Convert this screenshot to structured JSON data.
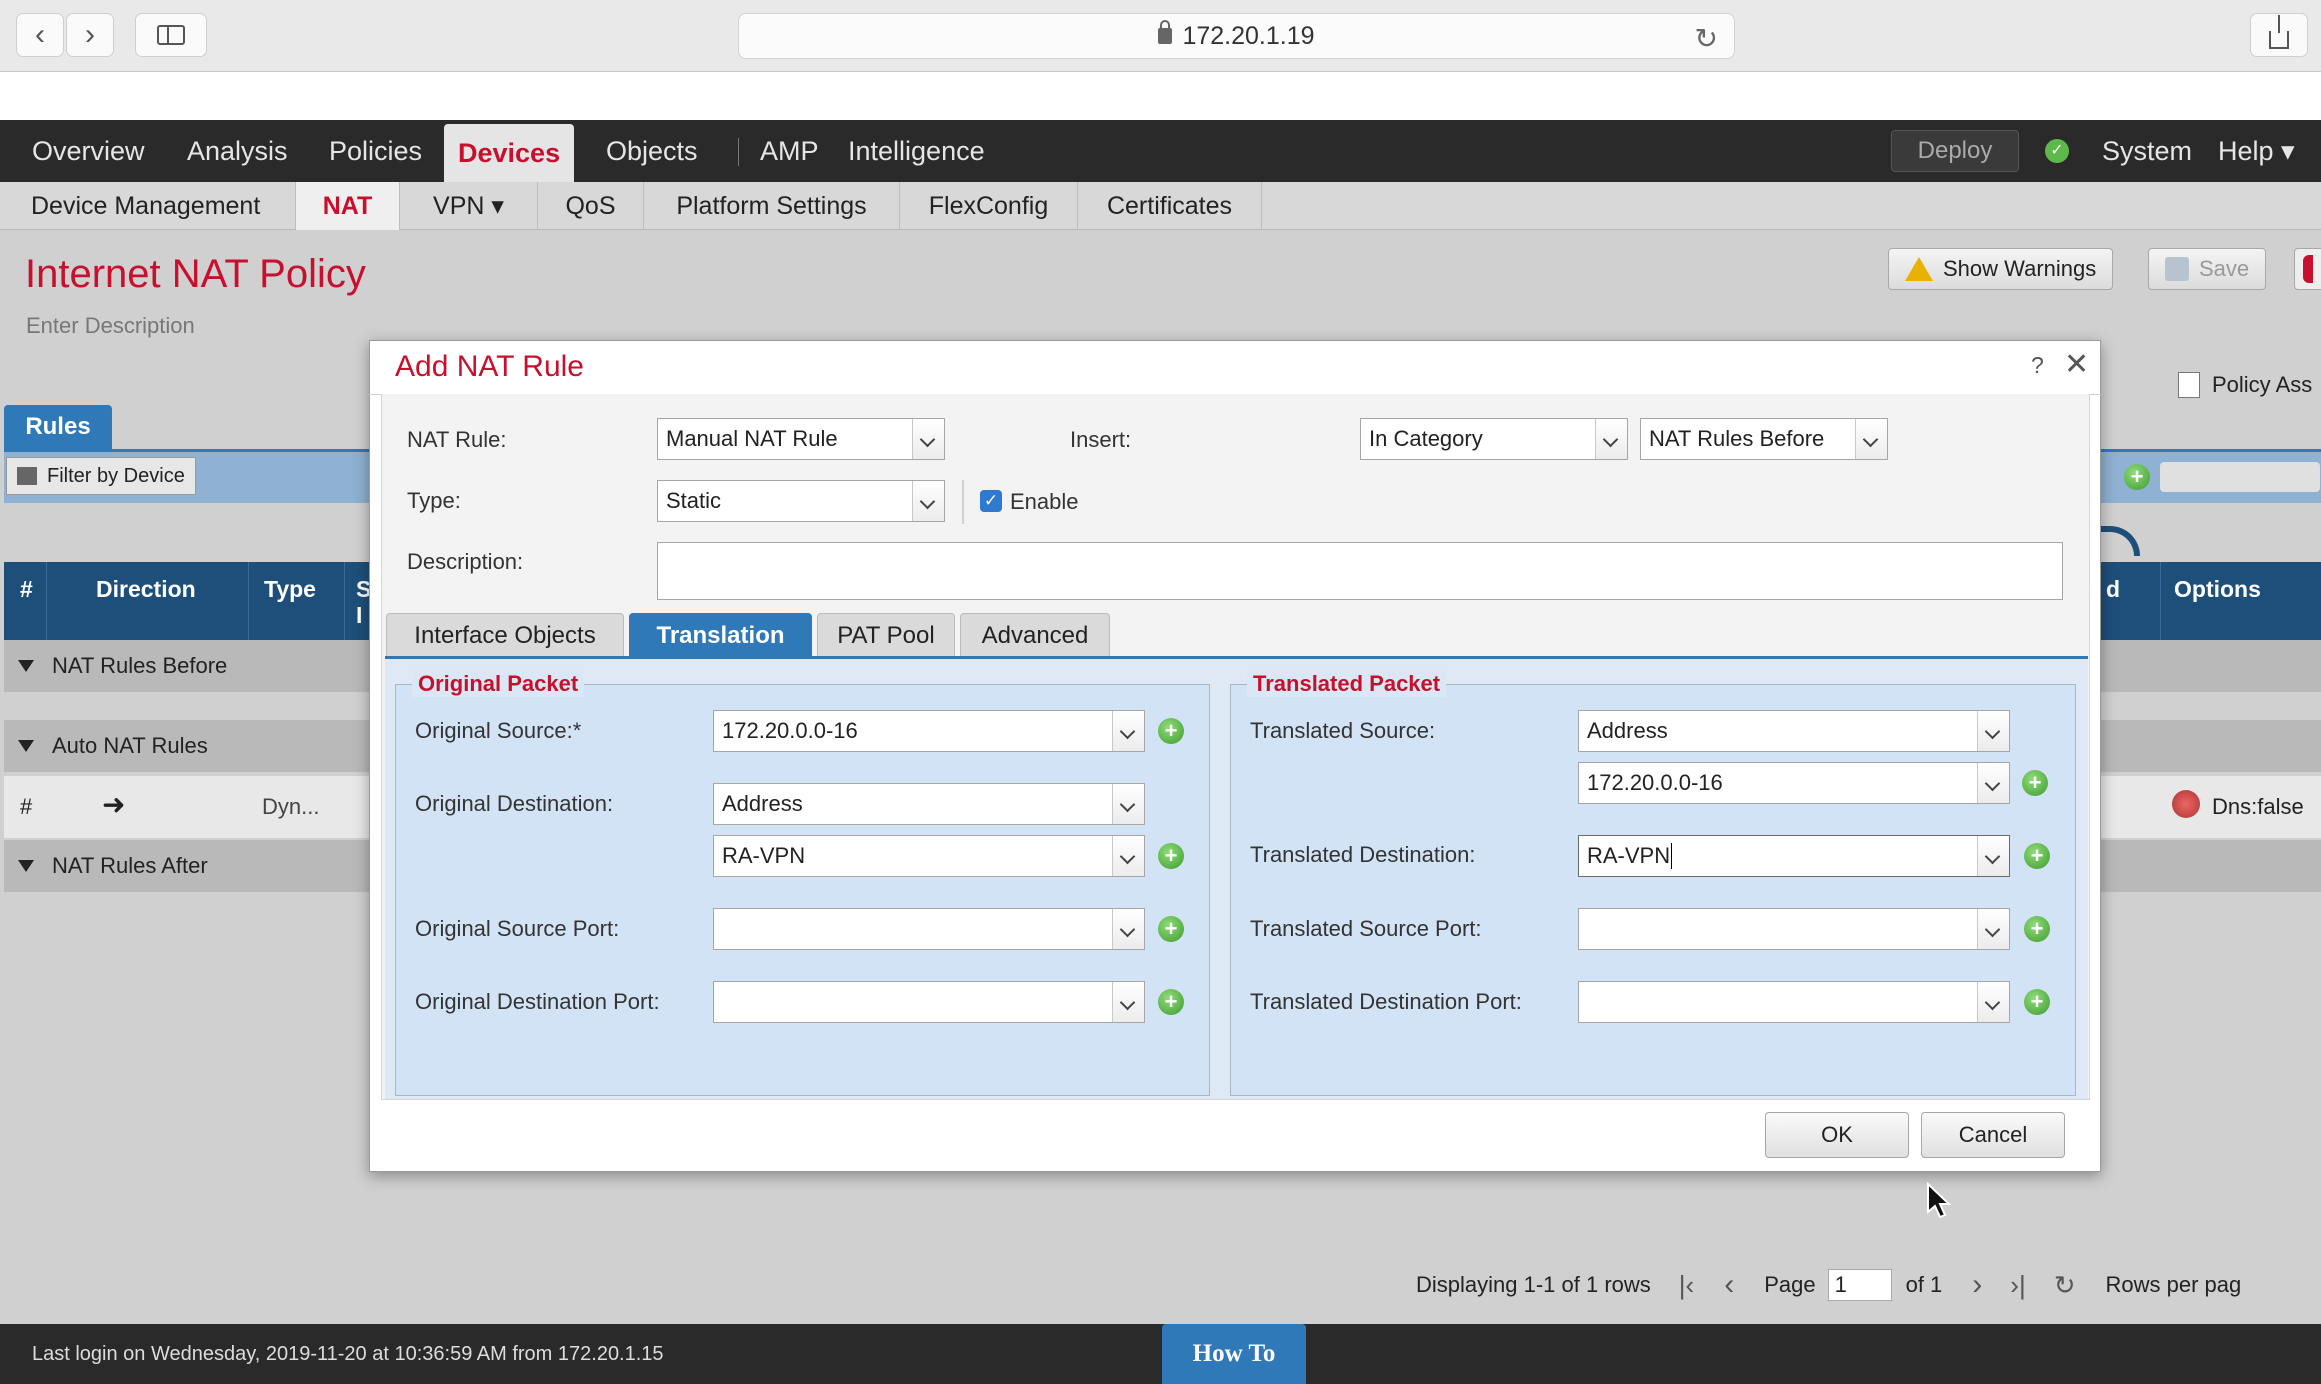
{
  "browser": {
    "url": "172.20.1.19"
  },
  "main_nav": {
    "items": [
      "Overview",
      "Analysis",
      "Policies",
      "Devices",
      "Objects",
      "AMP",
      "Intelligence"
    ],
    "deploy": "Deploy",
    "system": "System",
    "help": "Help ▾"
  },
  "sub_nav": {
    "items": [
      "Device Management",
      "NAT",
      "VPN ▾",
      "QoS",
      "Platform Settings",
      "FlexConfig",
      "Certificates"
    ]
  },
  "page": {
    "title": "Internet NAT Policy",
    "description_placeholder": "Enter Description",
    "show_warnings": "Show Warnings",
    "save": "Save",
    "policy_assignments": "Policy Ass",
    "rules_tab": "Rules",
    "filter_by_device": "Filter by Device",
    "columns": {
      "num": "#",
      "direction": "Direction",
      "type": "Type",
      "s": "S",
      "i": "I",
      "d": "d",
      "options": "Options"
    },
    "groups": {
      "before": "NAT Rules Before",
      "auto": "Auto NAT Rules",
      "after": "NAT Rules After"
    },
    "row": {
      "num": "#",
      "type": "Dyn...",
      "options": "Dns:false"
    },
    "pager": {
      "displaying": "Displaying 1-1 of 1 rows",
      "page_label": "Page",
      "page_value": "1",
      "of": "of 1",
      "rows_per_page": "Rows per pag"
    }
  },
  "footer": {
    "last_login": "Last login on Wednesday, 2019-11-20 at 10:36:59 AM from 172.20.1.15",
    "how_to": "How To"
  },
  "modal": {
    "title": "Add NAT Rule",
    "help": "?",
    "close": "✕",
    "nat_rule_label": "NAT Rule:",
    "nat_rule_value": "Manual NAT Rule",
    "insert_label": "Insert:",
    "insert_value": "In Category",
    "insert_position": "NAT Rules Before",
    "type_label": "Type:",
    "type_value": "Static",
    "enable_label": "Enable",
    "description_label": "Description:",
    "description_value": "",
    "tabs": [
      "Interface Objects",
      "Translation",
      "PAT Pool",
      "Advanced"
    ],
    "original": {
      "legend": "Original Packet",
      "source_label": "Original Source:*",
      "source_value": "172.20.0.0-16",
      "dest_label": "Original Destination:",
      "dest_type": "Address",
      "dest_value": "RA-VPN",
      "src_port_label": "Original Source Port:",
      "src_port_value": "",
      "dst_port_label": "Original Destination Port:",
      "dst_port_value": ""
    },
    "translated": {
      "legend": "Translated Packet",
      "source_label": "Translated Source:",
      "source_type": "Address",
      "source_value": "172.20.0.0-16",
      "dest_label": "Translated Destination:",
      "dest_value": "RA-VPN",
      "src_port_label": "Translated Source Port:",
      "src_port_value": "",
      "dst_port_label": "Translated Destination Port:",
      "dst_port_value": ""
    },
    "ok": "OK",
    "cancel": "Cancel"
  }
}
